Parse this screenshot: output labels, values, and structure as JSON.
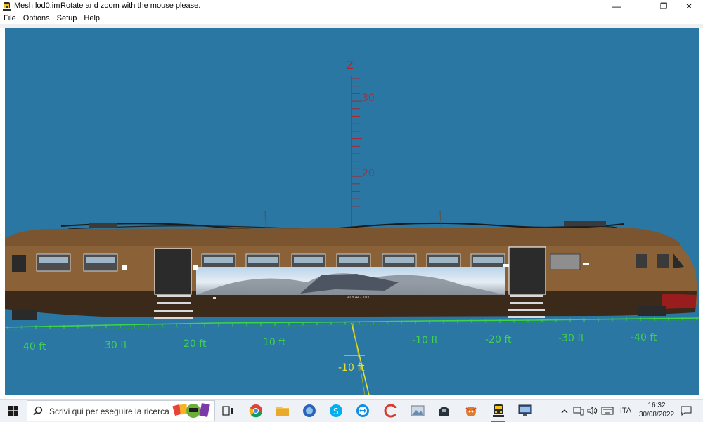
{
  "window": {
    "title": "Mesh lod0.im",
    "message": "Rotate and zoom with the mouse please.",
    "min_glyph": "—",
    "max_glyph": "❐",
    "close_glyph": "✕"
  },
  "menu": {
    "items": [
      "File",
      "Options",
      "Setup",
      "Help"
    ]
  },
  "viewer": {
    "background": "#2a77a3",
    "z_axis": {
      "label": "Z",
      "color": "#b3232a",
      "ticks": [
        "30",
        "20"
      ]
    },
    "ground_axis": {
      "color": "#3fd24a",
      "labels_left": [
        "40 ft",
        "30 ft",
        "20 ft",
        "10 ft"
      ],
      "labels_right": [
        "-10 ft",
        "-20 ft",
        "-30 ft",
        "-40 ft"
      ]
    },
    "depth_axis": {
      "color": "#e5e02c",
      "label": "-10 ft"
    },
    "model": {
      "body_color": "#8b6238",
      "lower_color": "#3b2a1a",
      "number_text": "ALn 442 101"
    }
  },
  "taskbar": {
    "search_placeholder": "Scrivi qui per eseguire la ricerca",
    "language": "ITA",
    "time": "16:32",
    "date": "30/08/2022"
  },
  "icons": {
    "window": "train-app-icon",
    "start": "windows-start-icon",
    "search": "search-icon"
  }
}
